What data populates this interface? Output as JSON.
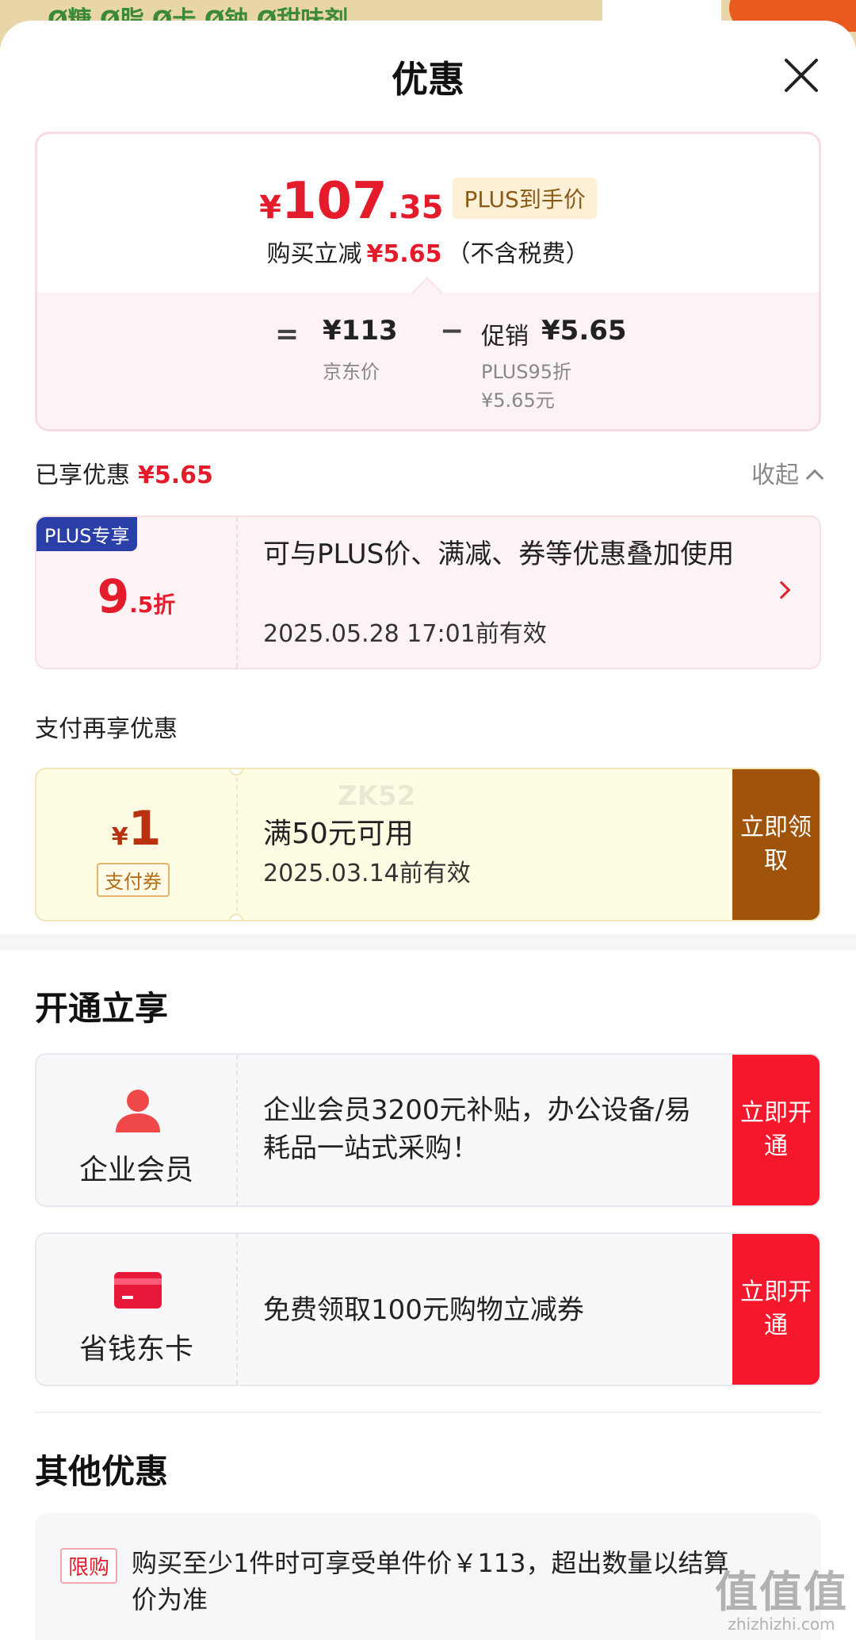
{
  "backdrop": {
    "strip_text": "Ø糖 Ø脂 Ø卡 Ø钠 Ø甜味剂"
  },
  "header": {
    "title": "优惠",
    "close_icon": "close-icon"
  },
  "price_card": {
    "currency": "¥",
    "price_int": "107",
    "price_dec": ".35",
    "plus_tag": "PLUS到手价",
    "reduce_prefix": "购买立减",
    "reduce_value": "¥5.65",
    "reduce_suffix": "（不含税费）",
    "eq": "=",
    "jd_price": "¥113",
    "jd_label": "京东价",
    "minus": "−",
    "promo_label": "促销",
    "promo_value": "¥5.65",
    "promo_sub1": "PLUS95折",
    "promo_sub2": "¥5.65元"
  },
  "enjoyed": {
    "label": "已享优惠",
    "value": "¥5.65",
    "collapse": "收起"
  },
  "plus_coupon": {
    "badge": "PLUS专享",
    "disc_big": "9",
    "disc_small": ".5折",
    "desc": "可与PLUS价、满减、券等优惠叠加使用",
    "date": "2025.05.28 17:01前有效"
  },
  "pay_section": {
    "title": "支付再享优惠",
    "currency": "¥",
    "amount": "1",
    "tag": "支付券",
    "condition": "满50元可用",
    "date": "2025.03.14前有效",
    "watermark": "ZK52",
    "button": "立即领取"
  },
  "open_section": {
    "title": "开通立享",
    "items": [
      {
        "name": "企业会员",
        "icon": "person-icon",
        "desc": "企业会员3200元补贴，办公设备/易耗品一站式采购！",
        "button": "立即开通"
      },
      {
        "name": "省钱东卡",
        "icon": "card-icon",
        "desc": "免费领取100元购物立减券",
        "button": "立即开通"
      }
    ]
  },
  "other_section": {
    "title": "其他优惠",
    "tag": "限购",
    "text": "购买至少1件时可享受单件价￥113，超出数量以结算价为准"
  },
  "watermark": {
    "big": "值值值",
    "small": "zhizhizhi.com"
  },
  "colors": {
    "accent_red": "#e31b2b",
    "plus_blue": "#2b3fa8",
    "claim_brown": "#a0530b",
    "open_red": "#f5172c"
  }
}
